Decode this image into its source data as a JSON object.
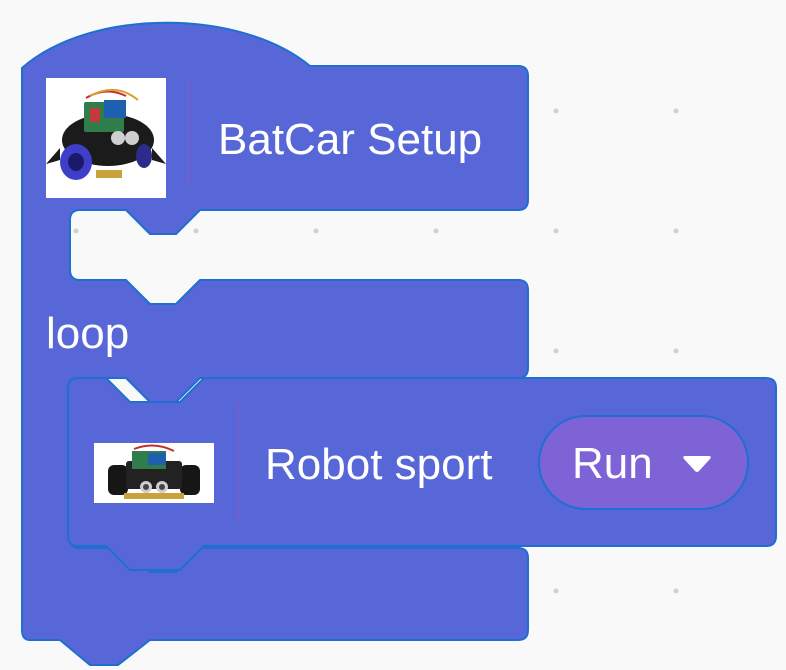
{
  "blocks": {
    "setup": {
      "label": "BatCar Setup",
      "image_icon": "robot-car-top-view-icon"
    },
    "loop": {
      "label": "loop"
    },
    "robot_sport": {
      "label": "Robot sport",
      "image_icon": "robot-car-front-view-icon",
      "dropdown": {
        "selected": "Run",
        "arrow_icon": "triangle-down-icon"
      }
    }
  },
  "colors": {
    "block_fill": "#5767d8",
    "block_stroke": "#1f6fd0",
    "dropdown_fill": "#7d63d6",
    "workspace_bg": "#f9f9f9",
    "grid_dot": "#d0d0d0"
  }
}
